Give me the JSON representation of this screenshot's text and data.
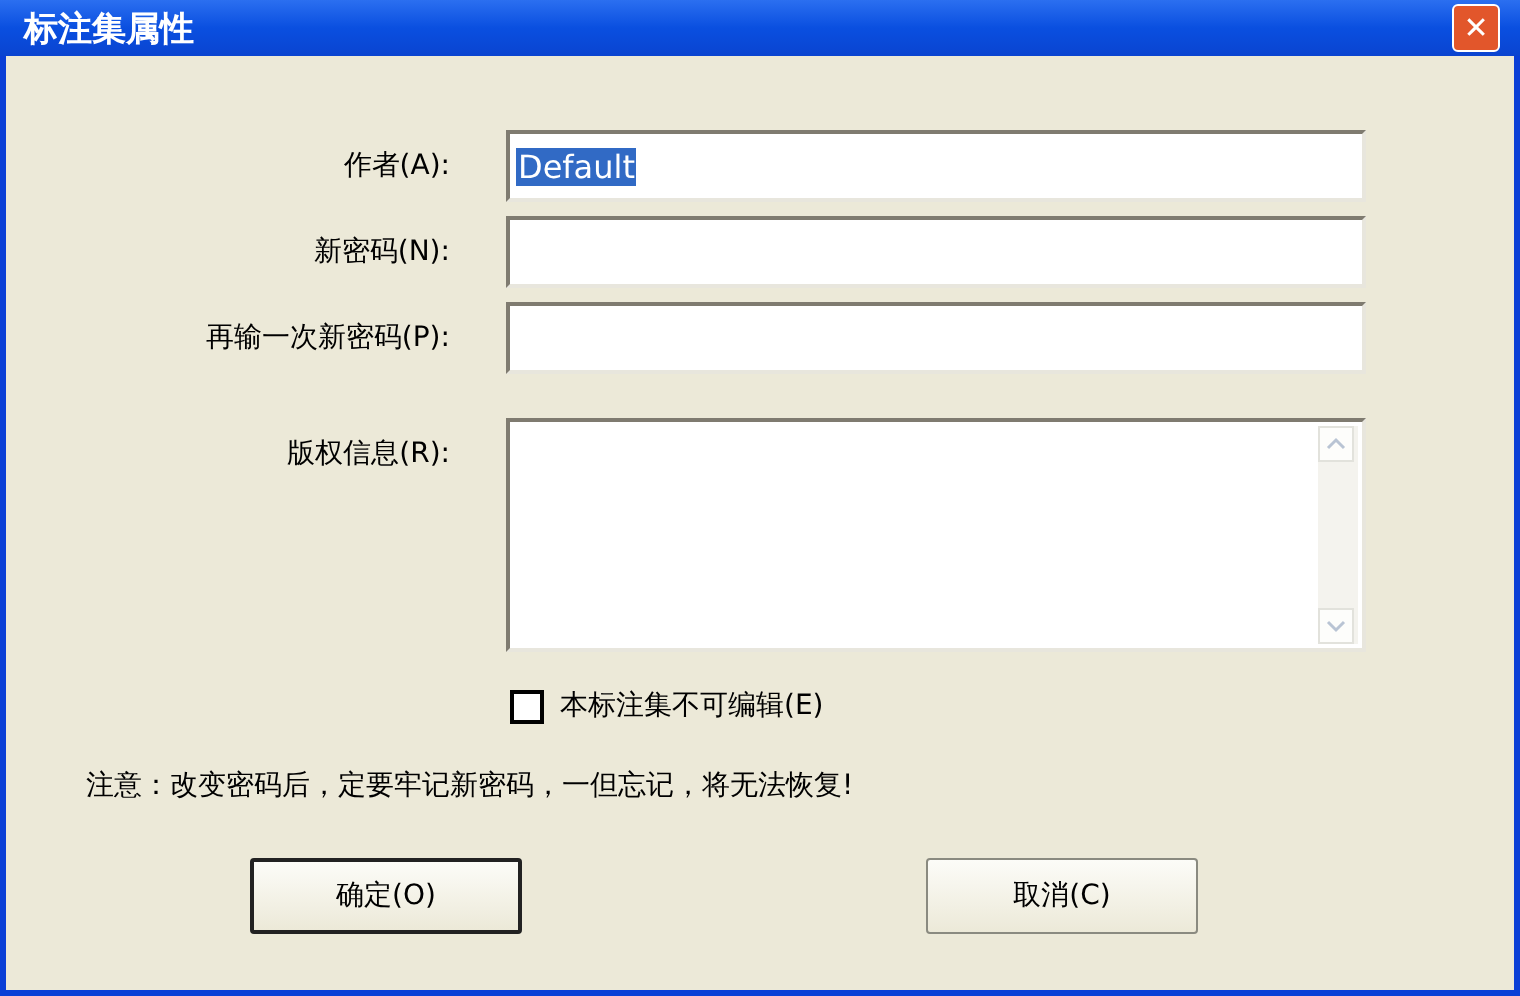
{
  "window": {
    "title": "标注集属性",
    "close": "✕"
  },
  "fields": [
    {
      "kind": "line",
      "label": "作者(A):",
      "value": "Default",
      "highlighted": true
    },
    {
      "kind": "line",
      "label": "新密码(N):"
    },
    {
      "kind": "line",
      "label": "再输一次新密码(P):"
    },
    {
      "kind": "area",
      "label": "版权信息(R):"
    }
  ],
  "checkbox": {
    "label": "本标注集不可编辑(E)",
    "checked": false
  },
  "note": "注意：改变密码后，定要牢记新密码，一但忘记，将无法恢复!",
  "buttons": [
    {
      "label": "确定(O)",
      "default": true
    },
    {
      "label": "取消(C)",
      "default": false
    }
  ]
}
